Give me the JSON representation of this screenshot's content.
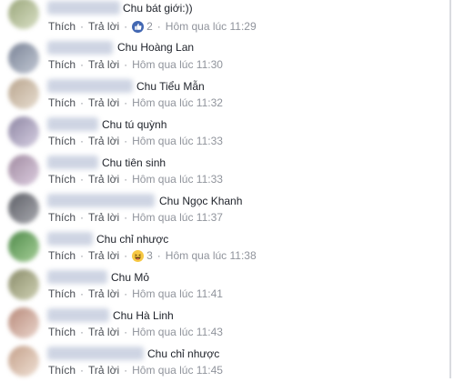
{
  "comments": [
    {
      "text": "Chu bát giới:))",
      "like": "Thích",
      "reply": "Trả lời",
      "reaction": "like",
      "count": "2",
      "time": "Hôm qua lúc 11:29"
    },
    {
      "text": "Chu Hoàng Lan",
      "like": "Thích",
      "reply": "Trả lời",
      "time": "Hôm qua lúc 11:30"
    },
    {
      "text": "Chu Tiểu Mẫn",
      "like": "Thích",
      "reply": "Trả lời",
      "time": "Hôm qua lúc 11:32"
    },
    {
      "text": "Chu tú quỳnh",
      "like": "Thích",
      "reply": "Trả lời",
      "time": "Hôm qua lúc 11:33"
    },
    {
      "text": "Chu tiên sinh",
      "like": "Thích",
      "reply": "Trả lời",
      "time": "Hôm qua lúc 11:33"
    },
    {
      "text": "Chu Ngọc Khanh",
      "like": "Thích",
      "reply": "Trả lời",
      "time": "Hôm qua lúc 11:37"
    },
    {
      "text": "Chu chỉ nhược",
      "like": "Thích",
      "reply": "Trả lời",
      "reaction": "haha",
      "count": "3",
      "time": "Hôm qua lúc 11:38"
    },
    {
      "text": "Chu Mỏ",
      "like": "Thích",
      "reply": "Trả lời",
      "time": "Hôm qua lúc 11:41"
    },
    {
      "text": "Chu Hà Linh",
      "like": "Thích",
      "reply": "Trả lời",
      "time": "Hôm qua lúc 11:43"
    },
    {
      "text": "Chu chỉ nhược",
      "like": "Thích",
      "reply": "Trả lời",
      "time": "Hôm qua lúc 11:45"
    }
  ],
  "colors": {
    "text": "#1d2129",
    "meta": "#90949c",
    "action": "#4b4f56",
    "like_blue": "#4267b2",
    "haha_yellow": "#f7c843"
  }
}
